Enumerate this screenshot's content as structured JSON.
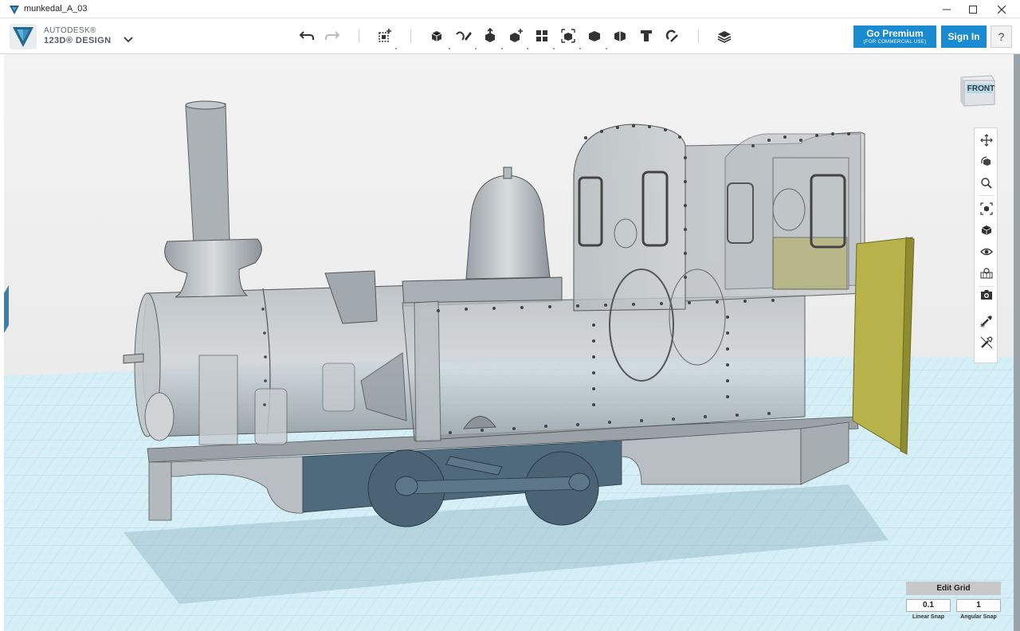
{
  "window": {
    "title": "munkedal_A_03"
  },
  "logo": {
    "line1": "AUTODESK®",
    "line2": "123D® DESIGN"
  },
  "toolbar": {
    "tools": [
      "undo-icon",
      "redo-icon",
      "add-primitive-icon",
      "primitives-icon",
      "sketch-icon",
      "construct-icon",
      "modify-icon",
      "pattern-icon",
      "grouping-icon",
      "combine-icon",
      "measure-icon",
      "text-icon",
      "snap-icon",
      "material-icon"
    ]
  },
  "account": {
    "premium_label": "Go Premium",
    "premium_sub": "(FOR COMMERCIAL USE)",
    "signin_label": "Sign In",
    "help_label": "?"
  },
  "viewcube": {
    "face_label": "FRONT"
  },
  "navbar": {
    "items": [
      "pan-icon",
      "orbit-icon",
      "zoom-icon",
      "fit-icon",
      "view-mode-icon",
      "visibility-icon",
      "material-view-icon",
      "screenshot-icon",
      "snap-tool-icon",
      "hide-icon"
    ]
  },
  "grid": {
    "button_label": "Edit Grid",
    "linear_snap_value": "0.1",
    "angular_snap_value": "1",
    "linear_snap_label": "Linear Snap",
    "angular_snap_label": "Angular Snap"
  },
  "colors": {
    "accent": "#1a8ad1",
    "grid_floor": "#d3eef6",
    "grid_line": "#9fd4e6",
    "model_body": "#a9b1b6",
    "chassis": "#4f6a7d",
    "door": "#b7b24a"
  }
}
